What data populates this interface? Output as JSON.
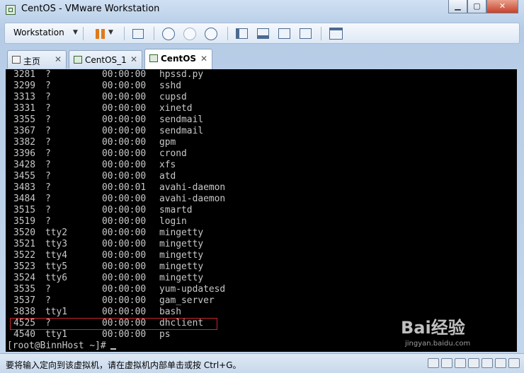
{
  "window": {
    "title": "CentOS - VMware Workstation"
  },
  "toolbar": {
    "menu_label": "Workstation"
  },
  "tabs": [
    {
      "label": "主页"
    },
    {
      "label": "CentOS_1"
    },
    {
      "label": "CentOS"
    }
  ],
  "terminal": {
    "rows": [
      {
        "pid": "3281",
        "tty": "?",
        "time": "00:00:00",
        "cmd": "hpssd.py"
      },
      {
        "pid": "3299",
        "tty": "?",
        "time": "00:00:00",
        "cmd": "sshd"
      },
      {
        "pid": "3313",
        "tty": "?",
        "time": "00:00:00",
        "cmd": "cupsd"
      },
      {
        "pid": "3331",
        "tty": "?",
        "time": "00:00:00",
        "cmd": "xinetd"
      },
      {
        "pid": "3355",
        "tty": "?",
        "time": "00:00:00",
        "cmd": "sendmail"
      },
      {
        "pid": "3367",
        "tty": "?",
        "time": "00:00:00",
        "cmd": "sendmail"
      },
      {
        "pid": "3382",
        "tty": "?",
        "time": "00:00:00",
        "cmd": "gpm"
      },
      {
        "pid": "3396",
        "tty": "?",
        "time": "00:00:00",
        "cmd": "crond"
      },
      {
        "pid": "3428",
        "tty": "?",
        "time": "00:00:00",
        "cmd": "xfs"
      },
      {
        "pid": "3455",
        "tty": "?",
        "time": "00:00:00",
        "cmd": "atd"
      },
      {
        "pid": "3483",
        "tty": "?",
        "time": "00:00:01",
        "cmd": "avahi-daemon"
      },
      {
        "pid": "3484",
        "tty": "?",
        "time": "00:00:00",
        "cmd": "avahi-daemon"
      },
      {
        "pid": "3515",
        "tty": "?",
        "time": "00:00:00",
        "cmd": "smartd"
      },
      {
        "pid": "3519",
        "tty": "?",
        "time": "00:00:00",
        "cmd": "login"
      },
      {
        "pid": "3520",
        "tty": "tty2",
        "time": "00:00:00",
        "cmd": "mingetty"
      },
      {
        "pid": "3521",
        "tty": "tty3",
        "time": "00:00:00",
        "cmd": "mingetty"
      },
      {
        "pid": "3522",
        "tty": "tty4",
        "time": "00:00:00",
        "cmd": "mingetty"
      },
      {
        "pid": "3523",
        "tty": "tty5",
        "time": "00:00:00",
        "cmd": "mingetty"
      },
      {
        "pid": "3524",
        "tty": "tty6",
        "time": "00:00:00",
        "cmd": "mingetty"
      },
      {
        "pid": "3535",
        "tty": "?",
        "time": "00:00:00",
        "cmd": "yum-updatesd"
      },
      {
        "pid": "3537",
        "tty": "?",
        "time": "00:00:00",
        "cmd": "gam_server"
      },
      {
        "pid": "3838",
        "tty": "tty1",
        "time": "00:00:00",
        "cmd": "bash"
      },
      {
        "pid": "4525",
        "tty": "?",
        "time": "00:00:00",
        "cmd": "dhclient"
      },
      {
        "pid": "4540",
        "tty": "tty1",
        "time": "00:00:00",
        "cmd": "ps"
      }
    ],
    "prompt": "[root@BinnHost ~]#"
  },
  "statusbar": {
    "text": "要将输入定向到该虚拟机，请在虚拟机内部单击或按 Ctrl+G。"
  },
  "watermark": {
    "text": "Bai经验",
    "sub": "jingyan.baidu.com"
  },
  "colors": {
    "terminal_bg": "#000000",
    "terminal_fg": "#c8c8c8",
    "highlight": "#c8262a",
    "pause_icon": "#e07a17"
  }
}
